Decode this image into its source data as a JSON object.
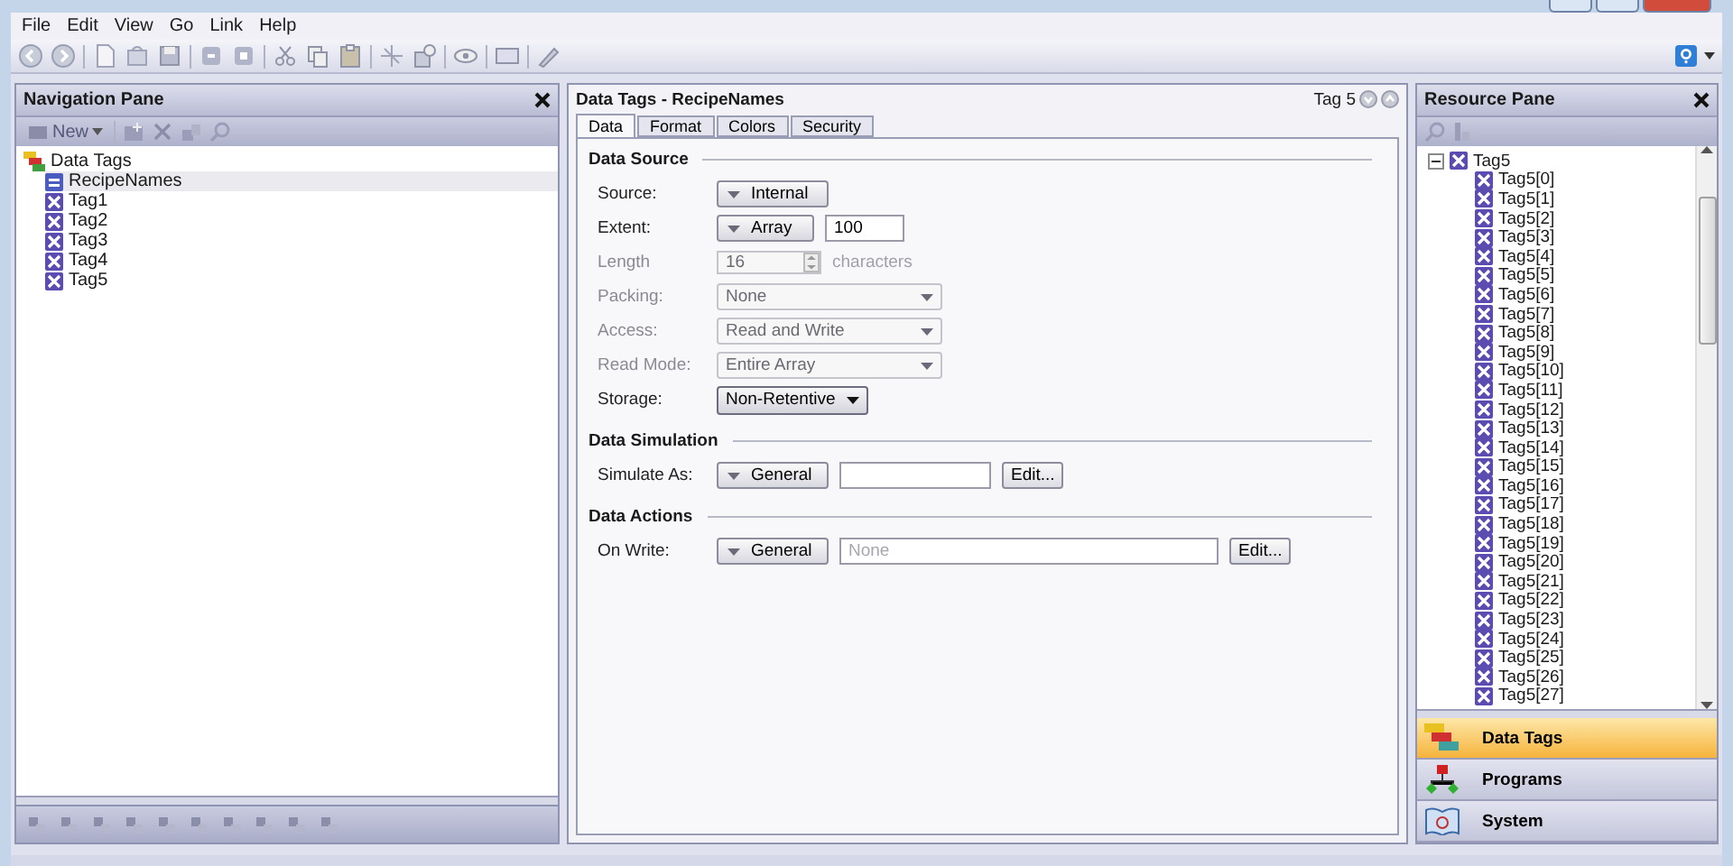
{
  "menu": [
    "File",
    "Edit",
    "View",
    "Go",
    "Link",
    "Help"
  ],
  "navigation_pane": {
    "title": "Navigation Pane",
    "new_button": {
      "label": "New",
      "disabled": true
    },
    "tree": [
      {
        "label": "Data Tags",
        "kind": "group",
        "selected": false,
        "children": [
          {
            "label": "RecipeNames",
            "kind": "string-tag",
            "selected": true
          },
          {
            "label": "Tag1",
            "kind": "tag",
            "selected": false
          },
          {
            "label": "Tag2",
            "kind": "tag",
            "selected": false
          },
          {
            "label": "Tag3",
            "kind": "tag",
            "selected": false
          },
          {
            "label": "Tag4",
            "kind": "tag",
            "selected": false
          },
          {
            "label": "Tag5",
            "kind": "tag",
            "selected": false
          }
        ]
      }
    ]
  },
  "editor": {
    "title": "Data Tags - RecipeNames",
    "tag_label": "Tag 5",
    "tabs": [
      {
        "label": "Data",
        "selected": true
      },
      {
        "label": "Format",
        "selected": false
      },
      {
        "label": "Colors",
        "selected": false
      },
      {
        "label": "Security",
        "selected": false
      }
    ],
    "sections": [
      {
        "title": "Data Source",
        "rows": [
          {
            "label": "Source:",
            "disabled": false,
            "control": {
              "kind": "dropdown-button",
              "value": "Internal"
            }
          },
          {
            "label": "Extent:",
            "disabled": false,
            "control": {
              "kind": "dropdown-button",
              "value": "Array"
            },
            "input": {
              "value": "100"
            }
          },
          {
            "label": "Length",
            "disabled": true,
            "control": {
              "kind": "spinner",
              "value": "16"
            },
            "suffix": "characters"
          },
          {
            "label": "Packing:",
            "disabled": true,
            "control": {
              "kind": "select",
              "value": "None"
            }
          },
          {
            "label": "Access:",
            "disabled": true,
            "control": {
              "kind": "select",
              "value": "Read and Write"
            }
          },
          {
            "label": "Read Mode:",
            "disabled": true,
            "control": {
              "kind": "select",
              "value": "Entire Array"
            }
          },
          {
            "label": "Storage:",
            "disabled": false,
            "control": {
              "kind": "menu-button",
              "value": "Non-Retentive"
            }
          }
        ]
      },
      {
        "title": "Data Simulation",
        "rows": [
          {
            "label": "Simulate As:",
            "disabled": false,
            "control": {
              "kind": "dropdown-button",
              "value": "General"
            },
            "input": {},
            "button": "Edit..."
          }
        ]
      },
      {
        "title": "Data Actions",
        "rows": [
          {
            "label": "On Write:",
            "disabled": false,
            "control": {
              "kind": "dropdown-button",
              "value": "General"
            },
            "input": {
              "placeholder": "None"
            },
            "button": "Edit..."
          }
        ]
      }
    ]
  },
  "resource_pane": {
    "title": "Resource Pane",
    "tree": [
      {
        "label": "Tag5",
        "kind": "tag",
        "expanded": true,
        "children": [
          {
            "label": "Tag5[0]",
            "kind": "tag"
          },
          {
            "label": "Tag5[1]",
            "kind": "tag"
          },
          {
            "label": "Tag5[2]",
            "kind": "tag"
          },
          {
            "label": "Tag5[3]",
            "kind": "tag"
          },
          {
            "label": "Tag5[4]",
            "kind": "tag"
          },
          {
            "label": "Tag5[5]",
            "kind": "tag"
          },
          {
            "label": "Tag5[6]",
            "kind": "tag"
          },
          {
            "label": "Tag5[7]",
            "kind": "tag"
          },
          {
            "label": "Tag5[8]",
            "kind": "tag"
          },
          {
            "label": "Tag5[9]",
            "kind": "tag"
          },
          {
            "label": "Tag5[10]",
            "kind": "tag"
          },
          {
            "label": "Tag5[11]",
            "kind": "tag"
          },
          {
            "label": "Tag5[12]",
            "kind": "tag"
          },
          {
            "label": "Tag5[13]",
            "kind": "tag"
          },
          {
            "label": "Tag5[14]",
            "kind": "tag"
          },
          {
            "label": "Tag5[15]",
            "kind": "tag"
          },
          {
            "label": "Tag5[16]",
            "kind": "tag"
          },
          {
            "label": "Tag5[17]",
            "kind": "tag"
          },
          {
            "label": "Tag5[18]",
            "kind": "tag"
          },
          {
            "label": "Tag5[19]",
            "kind": "tag"
          },
          {
            "label": "Tag5[20]",
            "kind": "tag"
          },
          {
            "label": "Tag5[21]",
            "kind": "tag"
          },
          {
            "label": "Tag5[22]",
            "kind": "tag"
          },
          {
            "label": "Tag5[23]",
            "kind": "tag"
          },
          {
            "label": "Tag5[24]",
            "kind": "tag"
          },
          {
            "label": "Tag5[25]",
            "kind": "tag"
          },
          {
            "label": "Tag5[26]",
            "kind": "tag"
          },
          {
            "label": "Tag5[27]",
            "kind": "tag"
          }
        ]
      }
    ],
    "nav_buttons": [
      {
        "label": "Data Tags",
        "kind": "data-tags",
        "selected": true
      },
      {
        "label": "Programs",
        "kind": "programs",
        "selected": false
      },
      {
        "label": "System",
        "kind": "system",
        "selected": false
      }
    ]
  }
}
